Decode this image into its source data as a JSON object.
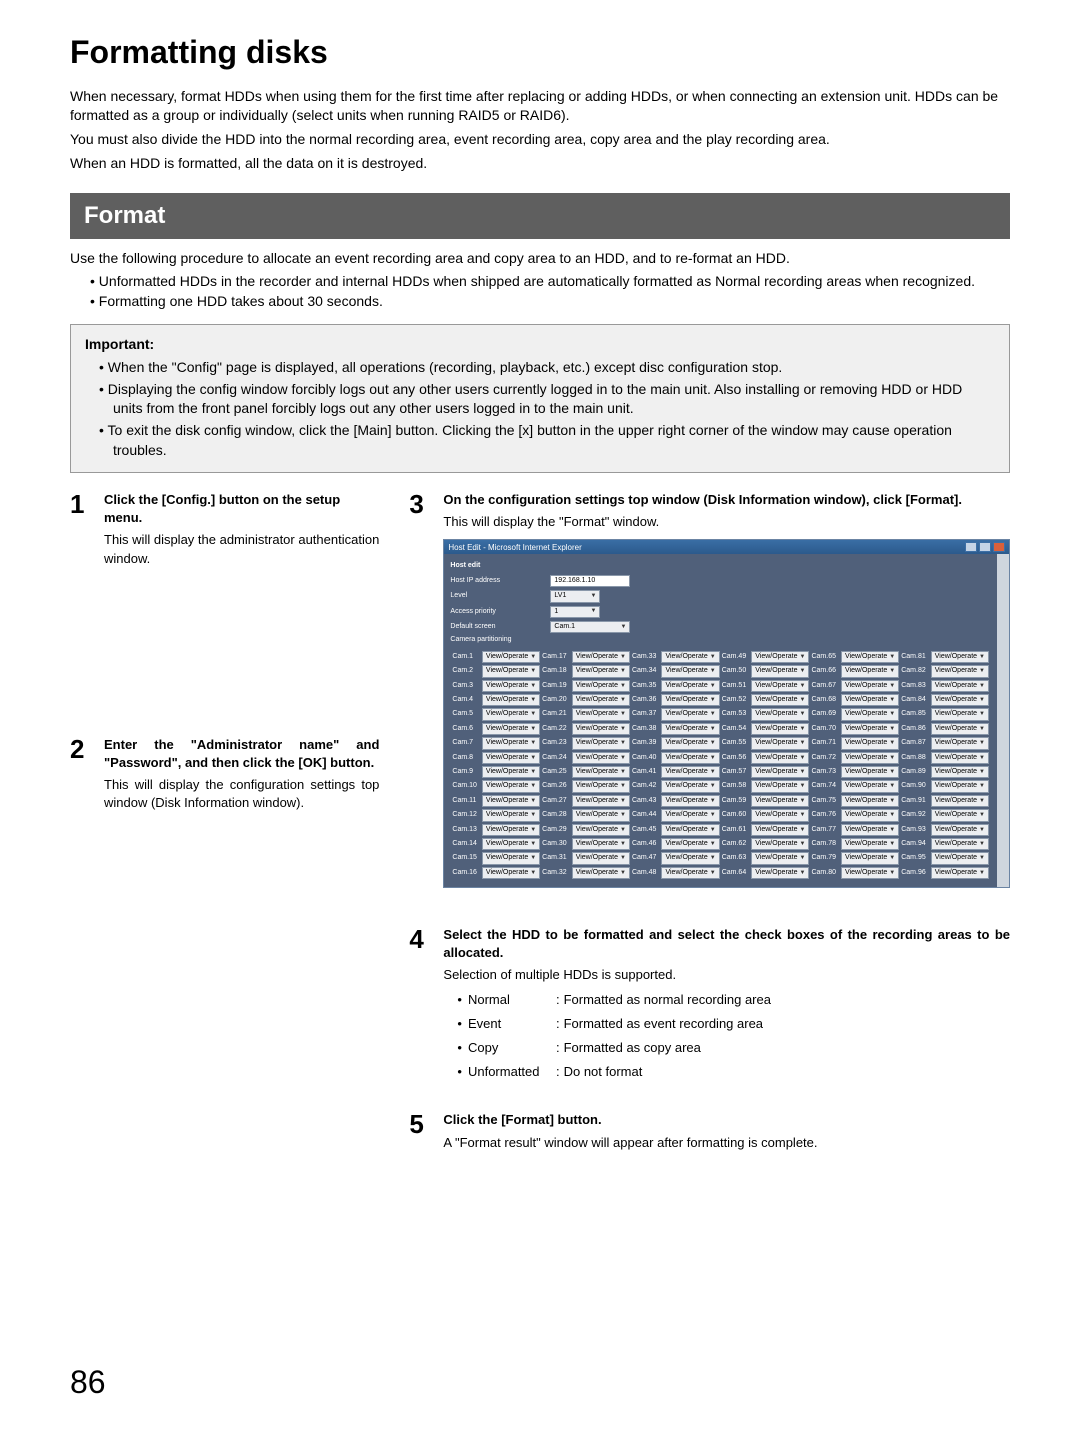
{
  "page": {
    "title": "Formatting disks",
    "number": "86"
  },
  "intro": {
    "p1": "When necessary, format HDDs when using them for the first time after replacing or adding HDDs, or when connecting an extension unit. HDDs can be formatted as a group or individually (select units when running RAID5 or RAID6).",
    "p2": "You must also divide the HDD into the normal recording area, event recording area, copy area and the play recording area.",
    "p3": "When an HDD is formatted, all the data on it is destroyed."
  },
  "section": {
    "heading": "Format",
    "lead": "Use the following procedure to allocate an event recording area and copy area to an HDD, and to re-format an HDD.",
    "bullets": [
      "Unformatted HDDs in the recorder and internal HDDs when shipped are automatically formatted as Normal recording areas when recognized.",
      "Formatting one HDD takes about 30 seconds."
    ]
  },
  "important": {
    "title": "Important:",
    "items": [
      "When the \"Config\" page is displayed, all operations (recording, playback, etc.) except disc configuration stop.",
      "Displaying the config window forcibly logs out any other users currently logged in to the main unit. Also installing or removing HDD or HDD units from the front panel forcibly logs out any other users logged in to the main unit.",
      "To exit the disk config window, click the [Main] button. Clicking the [x] button in the upper right corner of the window may cause operation troubles."
    ]
  },
  "steps": {
    "s1": {
      "num": "1",
      "bold": "Click the [Config.] button on the setup menu.",
      "text": "This will display the administrator authentication window."
    },
    "s2": {
      "num": "2",
      "bold": "Enter the \"Administrator name\" and \"Password\", and then click the [OK] button.",
      "text": "This will display the configuration settings top window (Disk Information window)."
    },
    "s3": {
      "num": "3",
      "bold": "On the configuration settings top window (Disk Information window), click [Format].",
      "text": "This will display the \"Format\" window."
    },
    "s4": {
      "num": "4",
      "bold": "Select the HDD to be formatted and select the check boxes of the recording areas to be allocated.",
      "text": "Selection of multiple HDDs is supported.",
      "options": [
        {
          "label": "Normal",
          "desc": "Formatted as normal recording area"
        },
        {
          "label": "Event",
          "desc": "Formatted as event recording area"
        },
        {
          "label": "Copy",
          "desc": "Formatted as copy area"
        },
        {
          "label": "Unformatted",
          "desc": "Do not format"
        }
      ]
    },
    "s5": {
      "num": "5",
      "bold": "Click the [Format] button.",
      "text": "A \"Format result\" window will appear after formatting is complete."
    }
  },
  "screenshot": {
    "windowTitle": "Host Edit - Microsoft Internet Explorer",
    "heading": "Host edit",
    "fields": {
      "ipLabel": "Host IP address",
      "ipValue": "192.168.1.10",
      "levelLabel": "Level",
      "levelValue": "LV1",
      "priorityLabel": "Access priority",
      "priorityValue": "1",
      "screenLabel": "Default screen",
      "screenValue": "Cam.1",
      "camPos": "Camera partitioning"
    },
    "cellValue": "View/Operate",
    "cams": [
      [
        "Cam.1",
        "Cam.17",
        "Cam.33",
        "Cam.49",
        "Cam.65",
        "Cam.81"
      ],
      [
        "Cam.2",
        "Cam.18",
        "Cam.34",
        "Cam.50",
        "Cam.66",
        "Cam.82"
      ],
      [
        "Cam.3",
        "Cam.19",
        "Cam.35",
        "Cam.51",
        "Cam.67",
        "Cam.83"
      ],
      [
        "Cam.4",
        "Cam.20",
        "Cam.36",
        "Cam.52",
        "Cam.68",
        "Cam.84"
      ],
      [
        "Cam.5",
        "Cam.21",
        "Cam.37",
        "Cam.53",
        "Cam.69",
        "Cam.85"
      ],
      [
        "Cam.6",
        "Cam.22",
        "Cam.38",
        "Cam.54",
        "Cam.70",
        "Cam.86"
      ],
      [
        "Cam.7",
        "Cam.23",
        "Cam.39",
        "Cam.55",
        "Cam.71",
        "Cam.87"
      ],
      [
        "Cam.8",
        "Cam.24",
        "Cam.40",
        "Cam.56",
        "Cam.72",
        "Cam.88"
      ],
      [
        "Cam.9",
        "Cam.25",
        "Cam.41",
        "Cam.57",
        "Cam.73",
        "Cam.89"
      ],
      [
        "Cam.10",
        "Cam.26",
        "Cam.42",
        "Cam.58",
        "Cam.74",
        "Cam.90"
      ],
      [
        "Cam.11",
        "Cam.27",
        "Cam.43",
        "Cam.59",
        "Cam.75",
        "Cam.91"
      ],
      [
        "Cam.12",
        "Cam.28",
        "Cam.44",
        "Cam.60",
        "Cam.76",
        "Cam.92"
      ],
      [
        "Cam.13",
        "Cam.29",
        "Cam.45",
        "Cam.61",
        "Cam.77",
        "Cam.93"
      ],
      [
        "Cam.14",
        "Cam.30",
        "Cam.46",
        "Cam.62",
        "Cam.78",
        "Cam.94"
      ],
      [
        "Cam.15",
        "Cam.31",
        "Cam.47",
        "Cam.63",
        "Cam.79",
        "Cam.95"
      ],
      [
        "Cam.16",
        "Cam.32",
        "Cam.48",
        "Cam.64",
        "Cam.80",
        "Cam.96"
      ]
    ]
  }
}
